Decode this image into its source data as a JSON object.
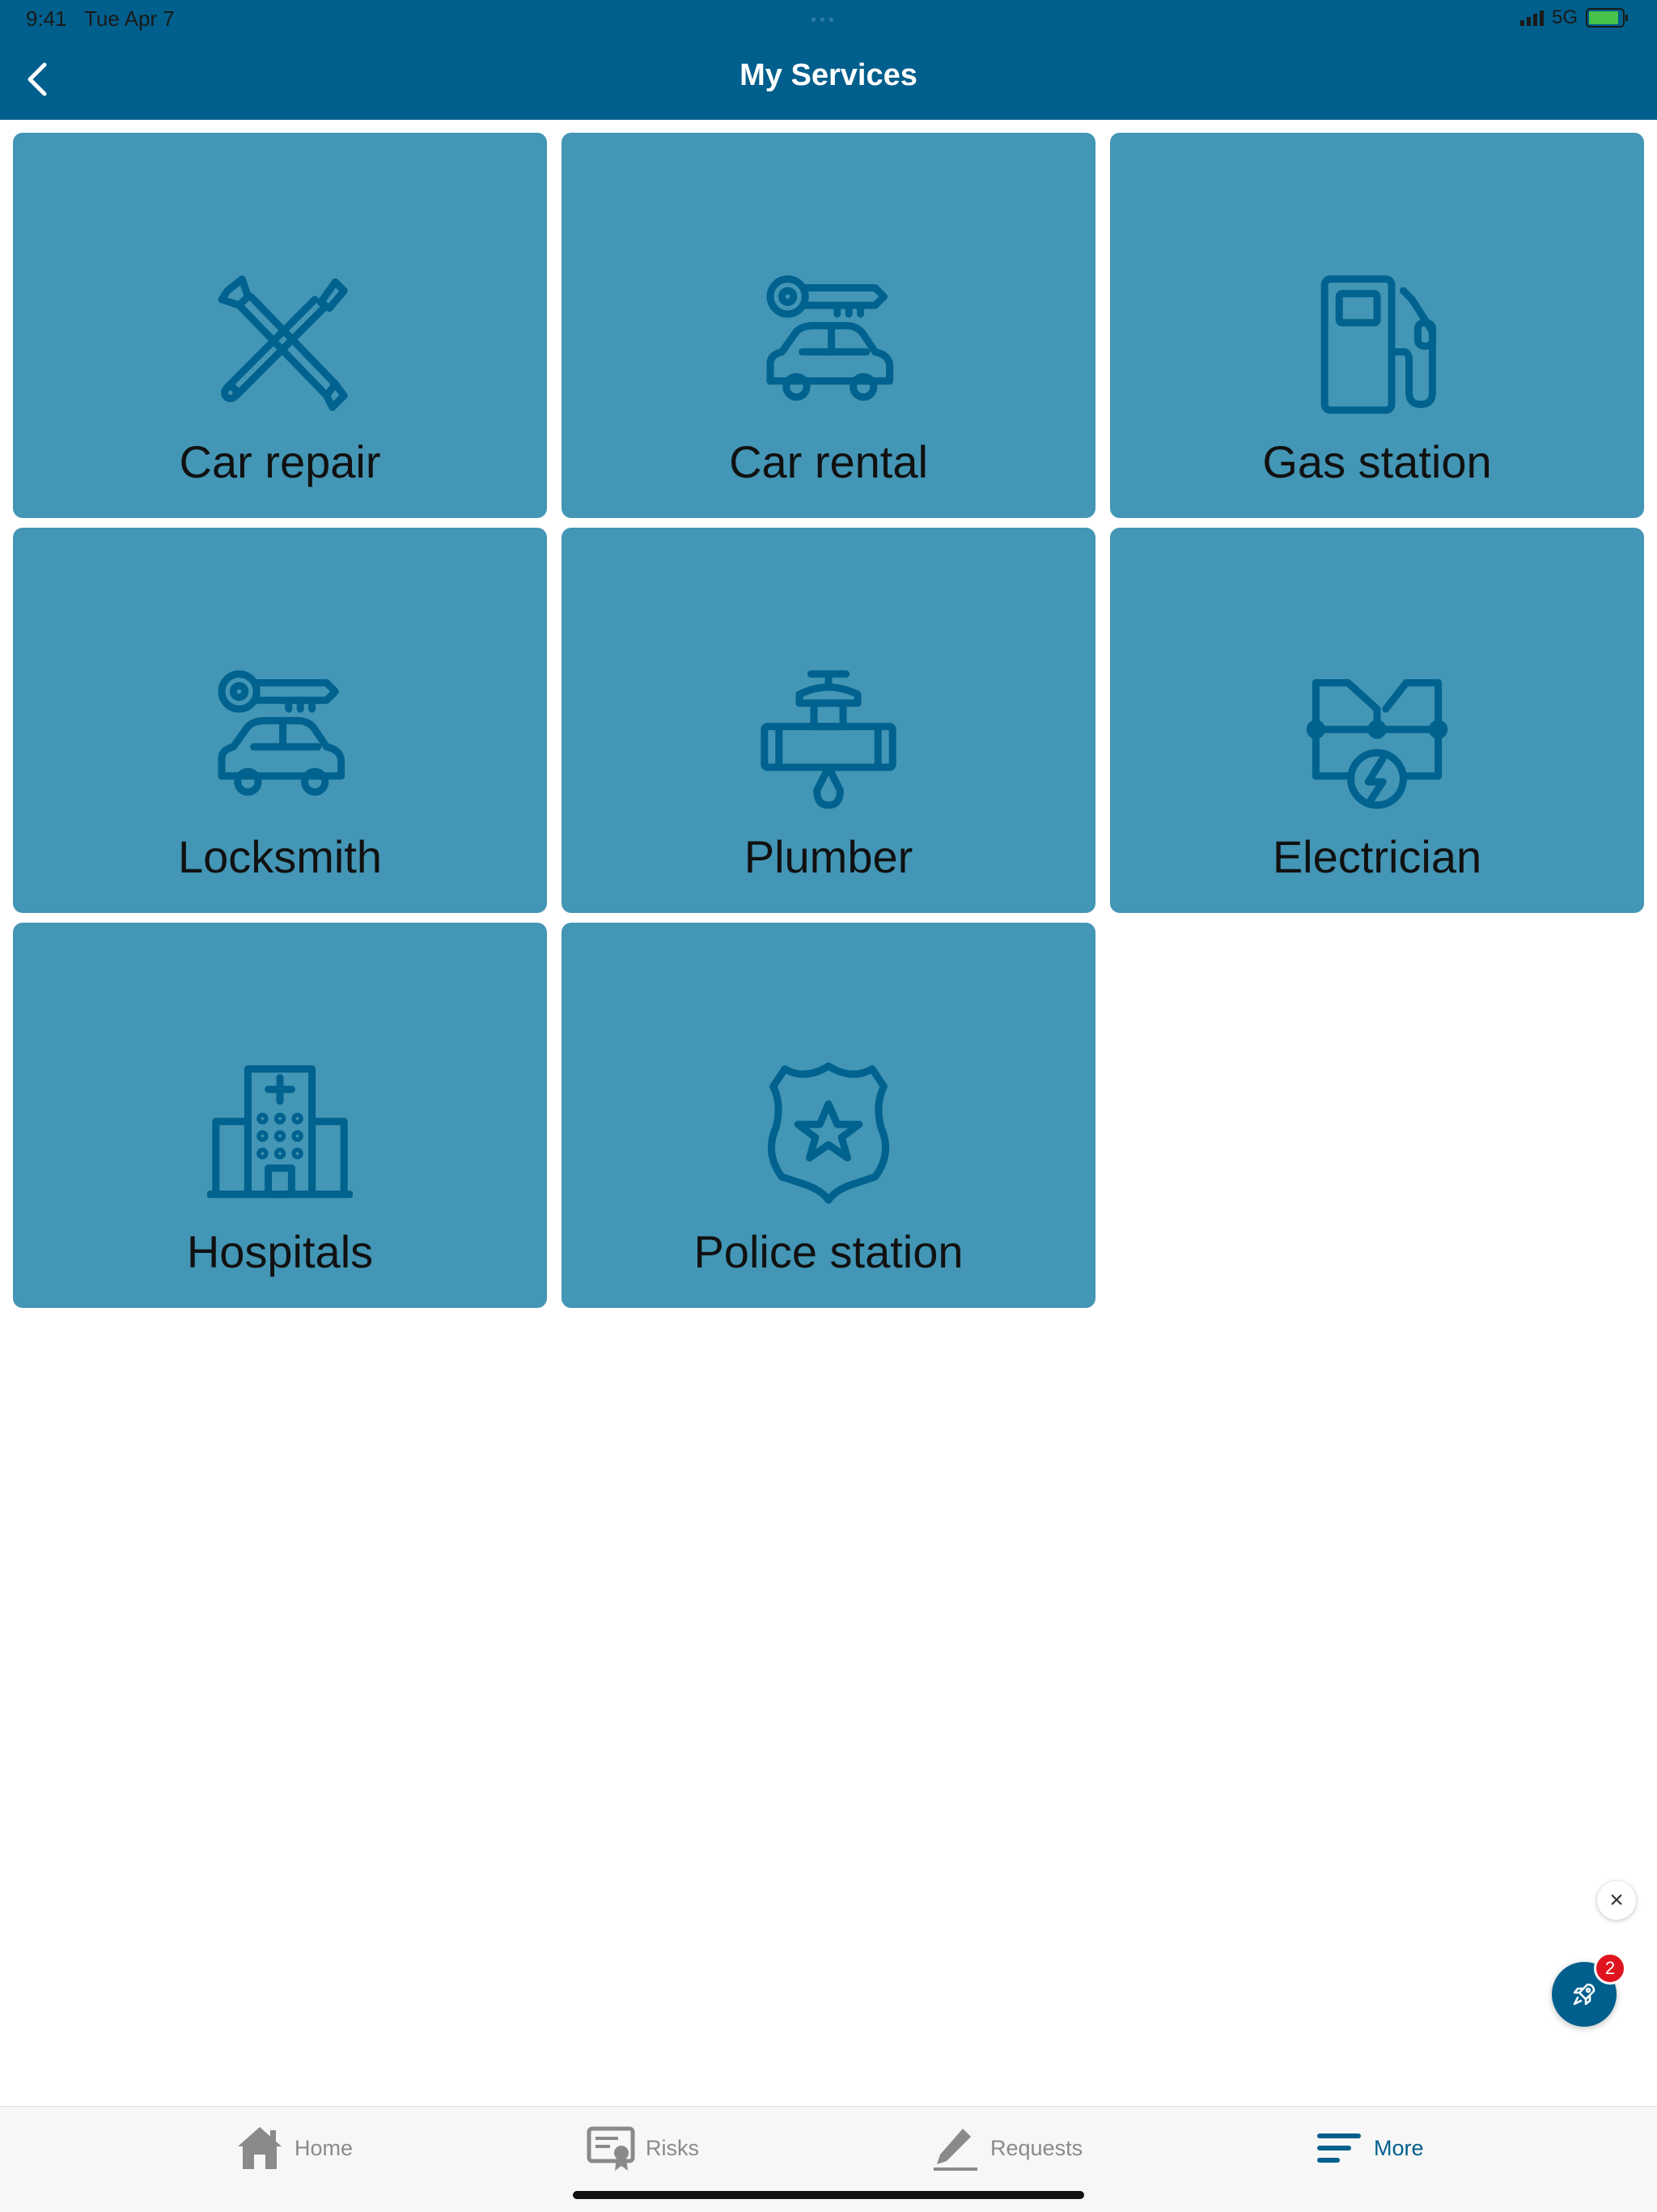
{
  "status_bar": {
    "time": "9:41",
    "date": "Tue Apr 7",
    "network": "5G"
  },
  "header": {
    "title": "My Services"
  },
  "services": [
    {
      "label": "Car repair",
      "icon": "wrench-screwdriver-icon"
    },
    {
      "label": "Car rental",
      "icon": "car-key-icon"
    },
    {
      "label": "Gas station",
      "icon": "fuel-pump-icon"
    },
    {
      "label": "Locksmith",
      "icon": "car-key-icon"
    },
    {
      "label": "Plumber",
      "icon": "pipe-valve-icon"
    },
    {
      "label": "Electrician",
      "icon": "circuit-bolt-icon"
    },
    {
      "label": "Hospitals",
      "icon": "hospital-icon"
    },
    {
      "label": "Police station",
      "icon": "police-badge-icon"
    }
  ],
  "floating": {
    "close_label": "×",
    "notification_count": "2"
  },
  "tab_bar": {
    "tabs": [
      {
        "label": "Home",
        "icon": "home-icon"
      },
      {
        "label": "Risks",
        "icon": "certificate-icon"
      },
      {
        "label": "Requests",
        "icon": "pencil-icon"
      },
      {
        "label": "More",
        "icon": "menu-icon"
      }
    ],
    "active": "More"
  },
  "colors": {
    "primary": "#005f8c",
    "tile": "#4396b5",
    "icon": "#00628f",
    "badge": "#e0141e"
  }
}
